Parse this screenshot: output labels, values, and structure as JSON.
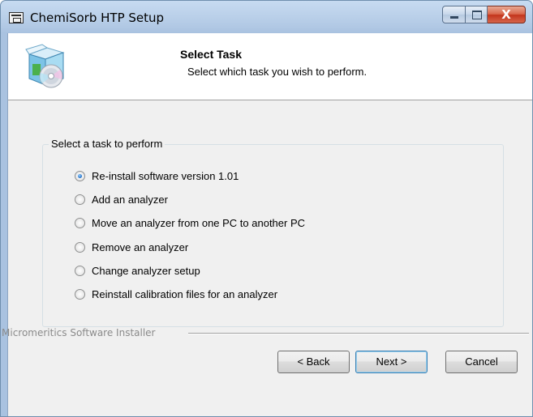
{
  "window": {
    "title": "ChemiSorb HTP Setup"
  },
  "caption_buttons": {
    "close_glyph": "X"
  },
  "header": {
    "title": "Select Task",
    "subtitle": "Select which task you wish to perform."
  },
  "group": {
    "label": "Select a task to perform",
    "options": [
      {
        "label": "Re-install software version 1.01",
        "checked": true
      },
      {
        "label": "Add an analyzer",
        "checked": false
      },
      {
        "label": "Move an analyzer from one PC to another PC",
        "checked": false
      },
      {
        "label": "Remove an analyzer",
        "checked": false
      },
      {
        "label": "Change analyzer setup",
        "checked": false
      },
      {
        "label": "Reinstall calibration files for an analyzer",
        "checked": false
      }
    ]
  },
  "footer": {
    "installer_label": "Micromeritics Software Installer",
    "back_label": "< Back",
    "next_label": "Next >",
    "cancel_label": "Cancel"
  },
  "colors": {
    "title_bar": "#b4cbe6",
    "close_button": "#c3341c",
    "radio_selected": "#1b6bc4"
  }
}
